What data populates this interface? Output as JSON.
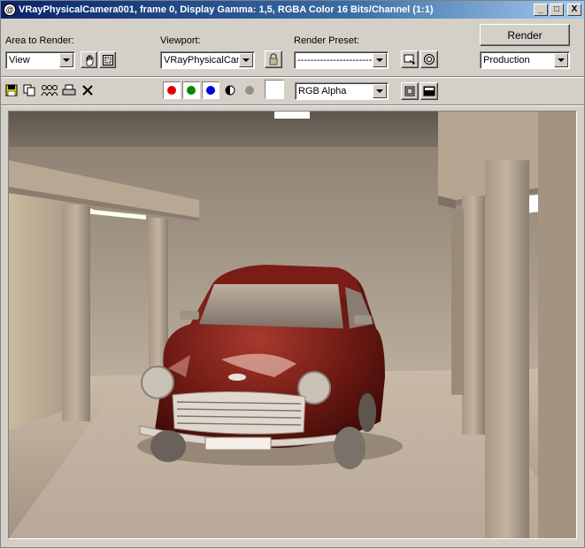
{
  "window": {
    "title": "VRayPhysicalCamera001, frame 0, Display Gamma: 1,5, RGBA Color 16 Bits/Channel (1:1)",
    "app_icon_glyph": "@",
    "minimize_glyph": "_",
    "maximize_glyph": "□",
    "close_glyph": "X"
  },
  "area_to_render": {
    "label": "Area to Render:",
    "value": "View"
  },
  "viewport": {
    "label": "Viewport:",
    "value": "VRayPhysicalCame"
  },
  "render_preset": {
    "label": "Render Preset:",
    "value": "------------------------"
  },
  "render_button": {
    "label": "Render"
  },
  "production": {
    "value": "Production"
  },
  "channel_display": {
    "value": "RGB Alpha"
  },
  "colors": {
    "red": "#e00000",
    "green": "#008a00",
    "blue": "#0000e0",
    "titlebar_start": "#0a246a",
    "titlebar_end": "#a6caf0"
  },
  "icons": [
    "save-icon",
    "copy-icon",
    "clone-icon",
    "print-icon",
    "clear-icon",
    "region-select-icon",
    "auto-region-icon",
    "lock-icon",
    "preset-load-icon",
    "environment-icon",
    "monochrome-icon",
    "swatch-icon",
    "display-mode-icon",
    "display-mode-alt-icon"
  ]
}
